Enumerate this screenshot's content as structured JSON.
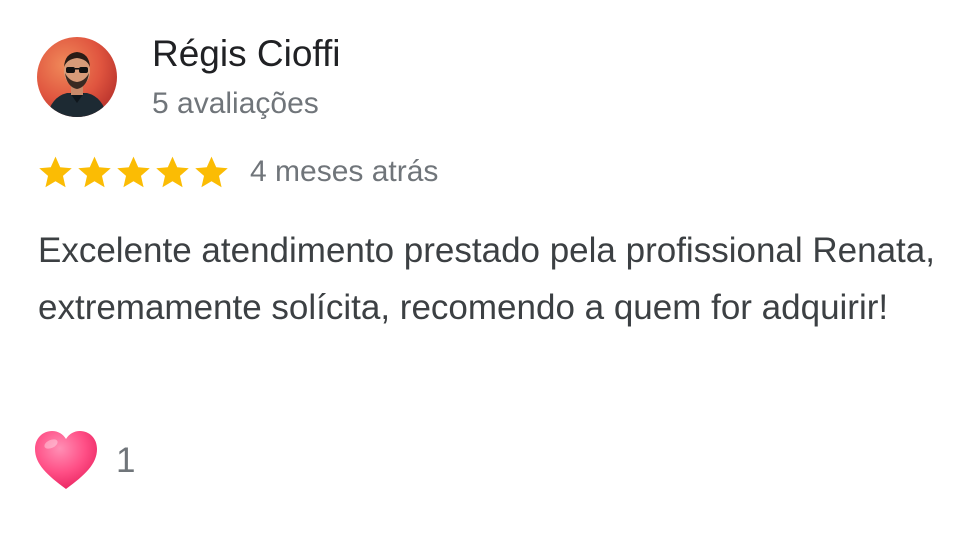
{
  "review": {
    "author_name": "Régis Cioffi",
    "review_count": "5 avaliações",
    "rating": 5,
    "rating_max": 5,
    "star_color": "#fbbc04",
    "date": "4 meses atrás",
    "text": "Excelente atendimento prestado pela profissional Renata, extremamente solícita, recomendo a quem for adquirir!",
    "reaction": {
      "icon": "heart-icon",
      "count": "1",
      "color": "#ff3f7f"
    }
  }
}
